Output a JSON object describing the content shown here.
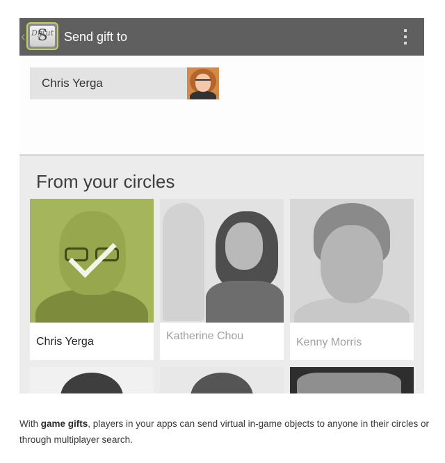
{
  "action_bar": {
    "title": "Send gift to",
    "app_icon_letter": "S",
    "app_icon_script_left": "Dgi",
    "app_icon_script_right": "ut",
    "icons": [
      "chevron-left-icon",
      "app-icon",
      "overflow-menu-icon"
    ]
  },
  "recipient": {
    "name": "Chris Yerga"
  },
  "section": {
    "title": "From your circles"
  },
  "people": [
    {
      "name": "Chris Yerga",
      "selected": true
    },
    {
      "name": "Katherine Chou",
      "selected": false
    },
    {
      "name": "Kenny Morris",
      "selected": false
    }
  ],
  "caption": {
    "prefix": "With ",
    "bold": "game gifts",
    "suffix": ", players in your apps can send virtual in-game objects to anyone in their circles or through multiplayer search."
  },
  "colors": {
    "action_bar": "#5f5f5f",
    "selected_overlay": "#a4b55c",
    "app_icon_border": "#c3d25a",
    "background": "#ececec"
  }
}
